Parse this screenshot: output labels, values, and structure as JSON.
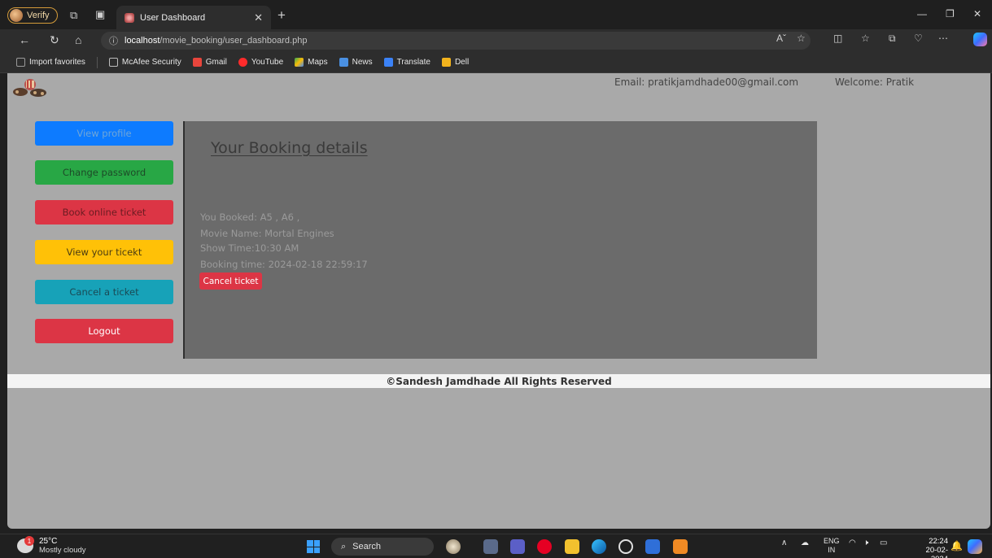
{
  "browser": {
    "profile_label": "Verify",
    "tab_title": "User Dashboard",
    "url_host": "localhost",
    "url_path": "/movie_booking/user_dashboard.php",
    "bookmarks": [
      {
        "label": "Import favorites",
        "color": "#9a9a9a"
      },
      {
        "label": "McAfee Security",
        "color": "#bdbdbd"
      },
      {
        "label": "Gmail",
        "color": "#e8453c"
      },
      {
        "label": "YouTube",
        "color": "#ff2b2b"
      },
      {
        "label": "Maps",
        "color": "#34a853"
      },
      {
        "label": "News",
        "color": "#4a90e2"
      },
      {
        "label": "Translate",
        "color": "#3b82f6"
      },
      {
        "label": "Dell",
        "color": "#f2b31d"
      }
    ]
  },
  "header": {
    "email": "Email: pratikjamdhade00@gmail.com",
    "welcome": "Welcome: Pratik"
  },
  "sidebar": {
    "buttons": [
      {
        "label": "View profile",
        "bg": "#0d7bff",
        "fg": "#6fa6d8"
      },
      {
        "label": "Change password",
        "bg": "#28a745",
        "fg": "#1d4a28"
      },
      {
        "label": "Book online ticket",
        "bg": "#dc3545",
        "fg": "#6b1c22"
      },
      {
        "label": "View your ticekt",
        "bg": "#ffc107",
        "fg": "#4a3c12"
      },
      {
        "label": "Cancel a ticket",
        "bg": "#17a2b8",
        "fg": "#1a4a55"
      },
      {
        "label": "Logout",
        "bg": "#dc3545",
        "fg": "#ffffff"
      }
    ]
  },
  "booking": {
    "heading": "Your Booking details",
    "seats": "You Booked: A5 , A6 ,",
    "movie": "Movie Name: Mortal Engines",
    "show_time": "Show Time:10:30 AM",
    "booking_time": "Booking time: 2024-02-18 22:59:17",
    "cancel_label": "Cancel ticket"
  },
  "footer": {
    "text": "©Sandesh Jamdhade All Rights Reserved"
  },
  "taskbar": {
    "temperature": "25°C",
    "weather": "Mostly cloudy",
    "weather_badge": "1",
    "search_label": "Search",
    "lang_top": "ENG",
    "lang_bottom": "IN",
    "time": "22:24",
    "date": "20-02-2024"
  }
}
